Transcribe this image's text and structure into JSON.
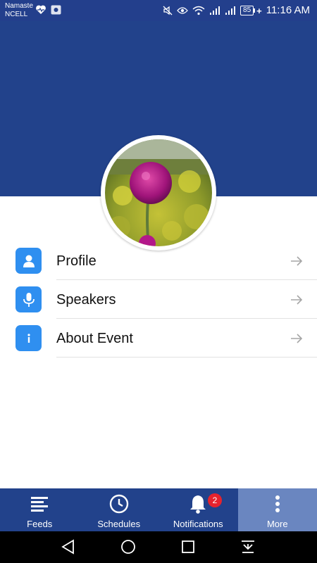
{
  "status_bar": {
    "carrier_line1": "Namaste",
    "carrier_line2": "NCELL",
    "battery": "85",
    "time": "11:16 AM",
    "icons": [
      "heart-rate-icon",
      "image-icon",
      "mute-icon",
      "eye-icon",
      "wifi-icon",
      "signal-icon",
      "signal-icon",
      "battery-icon"
    ]
  },
  "profile": {
    "avatar": "flower-photo"
  },
  "menu": {
    "items": [
      {
        "label": "Profile",
        "icon": "person-icon"
      },
      {
        "label": "Speakers",
        "icon": "microphone-icon"
      },
      {
        "label": "About Event",
        "icon": "info-icon"
      }
    ]
  },
  "bottom_nav": {
    "items": [
      {
        "label": "Feeds",
        "icon": "feeds-icon"
      },
      {
        "label": "Schedules",
        "icon": "clock-icon"
      },
      {
        "label": "Notifications",
        "icon": "bell-icon",
        "badge": "2"
      },
      {
        "label": "More",
        "icon": "more-vertical-icon",
        "active": true
      }
    ]
  },
  "colors": {
    "primary": "#22428b",
    "accent": "#2f8ff0",
    "active_tab": "#6a86c0",
    "badge": "#e5232e"
  }
}
